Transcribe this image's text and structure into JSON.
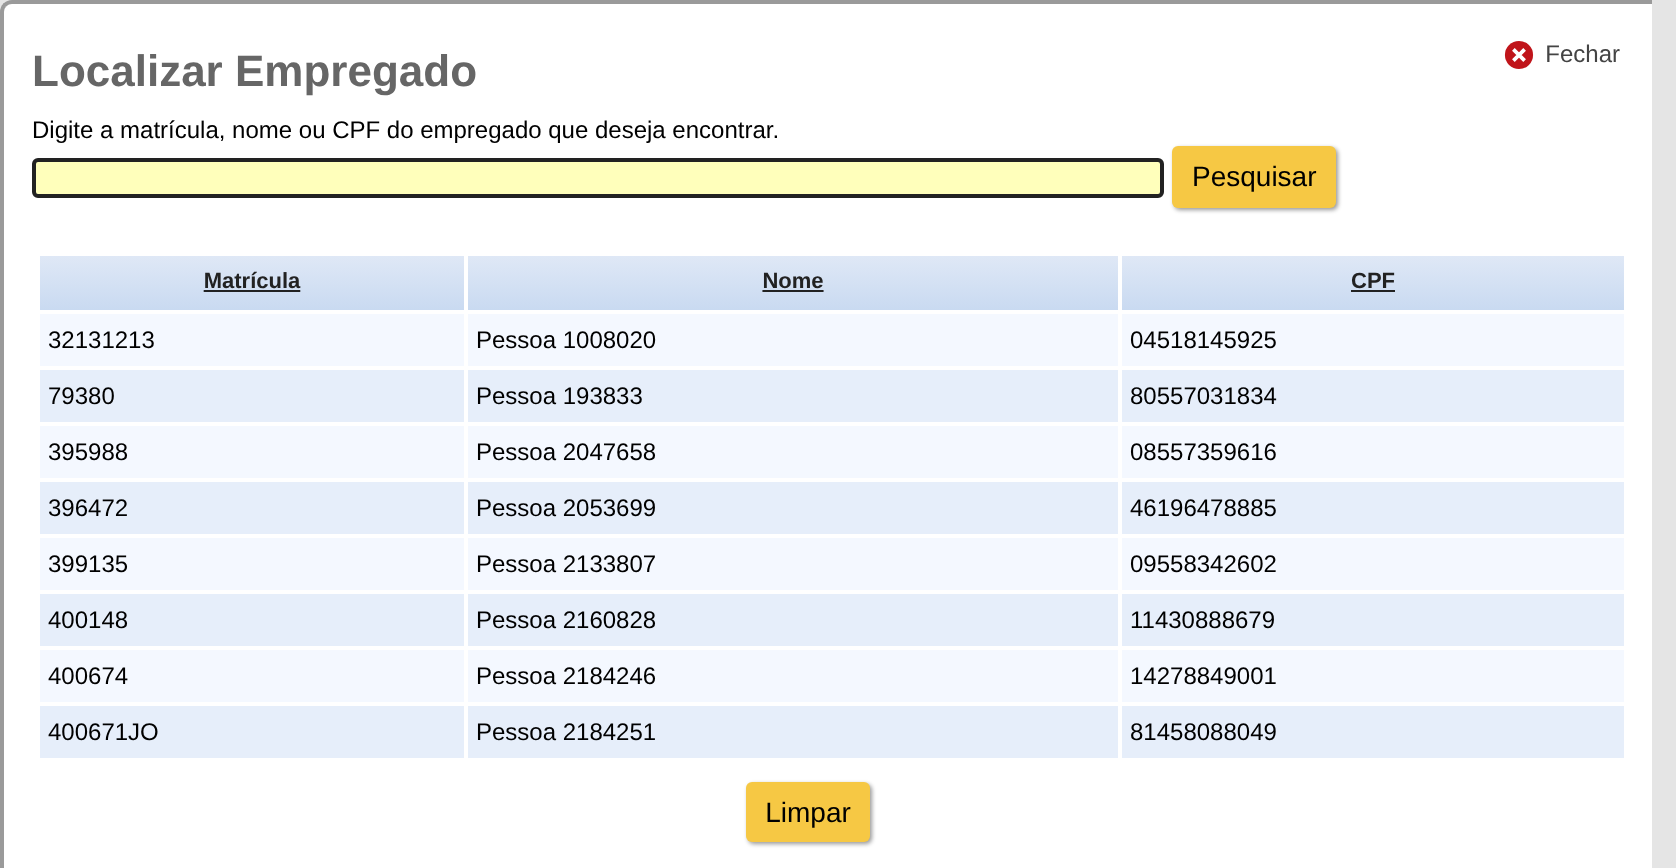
{
  "dialog": {
    "title": "Localizar Empregado",
    "close_label": "Fechar"
  },
  "search": {
    "instructions": "Digite a matrícula, nome ou CPF do empregado que deseja encontrar.",
    "button": "Pesquisar"
  },
  "table": {
    "columns": [
      "Matrícula",
      "Nome",
      "CPF"
    ],
    "rows": [
      [
        "32131213",
        "Pessoa 1008020",
        "04518145925"
      ],
      [
        "79380",
        "Pessoa 193833",
        "80557031834"
      ],
      [
        "395988",
        "Pessoa 2047658",
        "08557359616"
      ],
      [
        "396472",
        "Pessoa 2053699",
        "46196478885"
      ],
      [
        "399135",
        "Pessoa 2133807",
        "09558342602"
      ],
      [
        "400148",
        "Pessoa 2160828",
        "11430888679"
      ],
      [
        "400674",
        "Pessoa 2184246",
        "14278849001"
      ],
      [
        "400671JO",
        "Pessoa 2184251",
        "81458088049"
      ]
    ]
  },
  "clear_button": "Limpar"
}
